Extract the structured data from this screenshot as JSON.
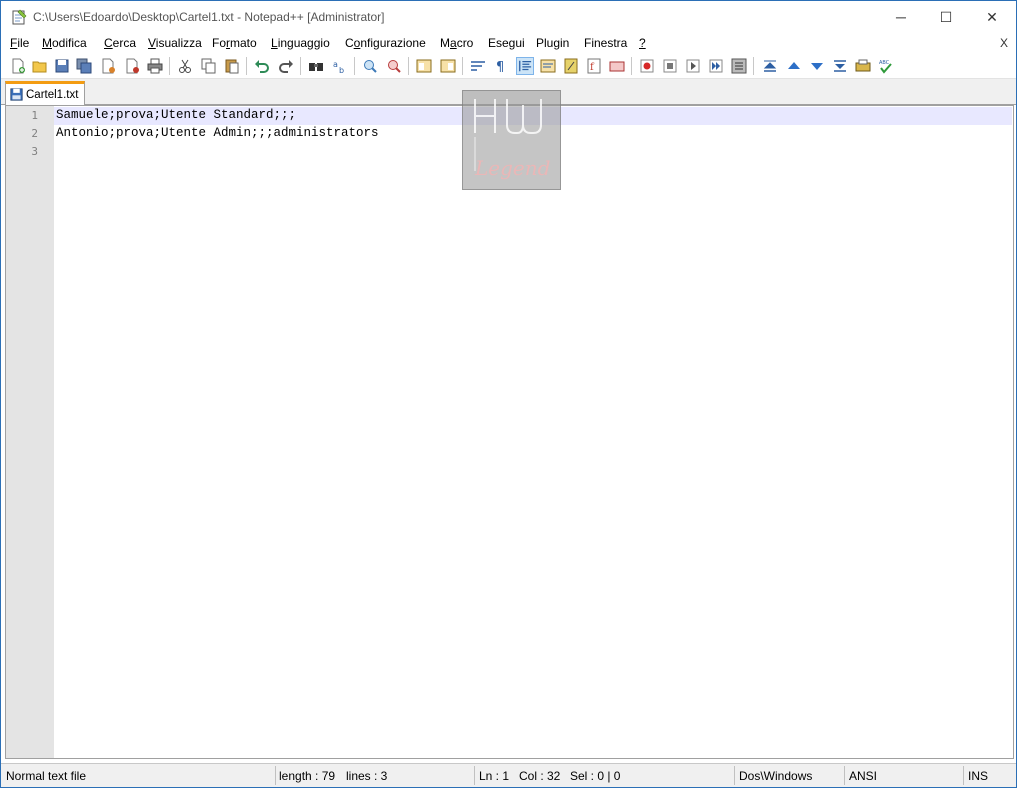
{
  "titlebar": {
    "title": "C:\\Users\\Edoardo\\Desktop\\Cartel1.txt - Notepad++ [Administrator]",
    "app_icon": "notepad-icon",
    "minimize": "─",
    "maximize": "☐",
    "close": "✕"
  },
  "menu": {
    "items": [
      {
        "key": "F",
        "rest": "ile"
      },
      {
        "key": "M",
        "rest": "odifica"
      },
      {
        "key": "C",
        "rest": "erca"
      },
      {
        "key": "V",
        "rest": "isualizza"
      },
      {
        "key": "",
        "pre": "Fo",
        "keymid": "r",
        "rest": "mato"
      },
      {
        "key": "L",
        "rest": "inguaggio"
      },
      {
        "key": "",
        "pre": "C",
        "keymid": "o",
        "rest": "nfigurazione"
      },
      {
        "key": "",
        "pre": "M",
        "keymid": "a",
        "rest": "cro"
      },
      {
        "key": "",
        "pre": "",
        "keymid": "",
        "rest": "Esegui"
      },
      {
        "key": "",
        "pre": "",
        "keymid": "",
        "rest": "Plugin"
      },
      {
        "key": "",
        "pre": "",
        "keymid": "",
        "rest": "Finestra"
      },
      {
        "key": "?",
        "rest": ""
      }
    ],
    "close_doc": "X"
  },
  "toolbar": {
    "icons": [
      "new-file-icon",
      "open-file-icon",
      "save-icon",
      "save-all-icon",
      "close-icon",
      "close-all-icon",
      "print-icon",
      "cut-icon",
      "copy-icon",
      "paste-icon",
      "undo-icon",
      "redo-icon",
      "find-icon",
      "replace-icon",
      "zoom-in-icon",
      "zoom-out-icon",
      "sync-vertical-icon",
      "sync-horizontal-icon",
      "word-wrap-icon",
      "show-all-chars-icon",
      "indent-guide-icon",
      "doc-map-icon",
      "function-list-icon",
      "folder-workspace-icon",
      "monitoring-icon",
      "record-macro-icon",
      "stop-record-icon",
      "play-macro-icon",
      "run-macro-multiple-icon",
      "save-macro-icon",
      "collapse-icon",
      "up-icon",
      "down-icon",
      "expand-icon",
      "launch-icon",
      "spellcheck-icon"
    ]
  },
  "tab": {
    "label": "Cartel1.txt",
    "icon": "floppy-disk-icon"
  },
  "editor": {
    "lines": [
      {
        "num": "1",
        "text": "Samuele;prova;Utente Standard;;;"
      },
      {
        "num": "2",
        "text": "Antonio;prova;Utente Admin;;;administrators"
      },
      {
        "num": "3",
        "text": ""
      }
    ]
  },
  "watermark": {
    "logo_letters": "HW",
    "logo_word": "Legend"
  },
  "statusbar": {
    "type": "Normal text file",
    "length": "length : 79",
    "lines": "lines : 3",
    "ln": "Ln : 1",
    "col": "Col : 32",
    "sel": "Sel : 0 | 0",
    "eol": "Dos\\Windows",
    "encoding": "ANSI",
    "mode": "INS"
  },
  "colors": {
    "tab_accent": "#f39c12",
    "current_line": "#e8e8ff",
    "gutter": "#e4e4e4"
  }
}
